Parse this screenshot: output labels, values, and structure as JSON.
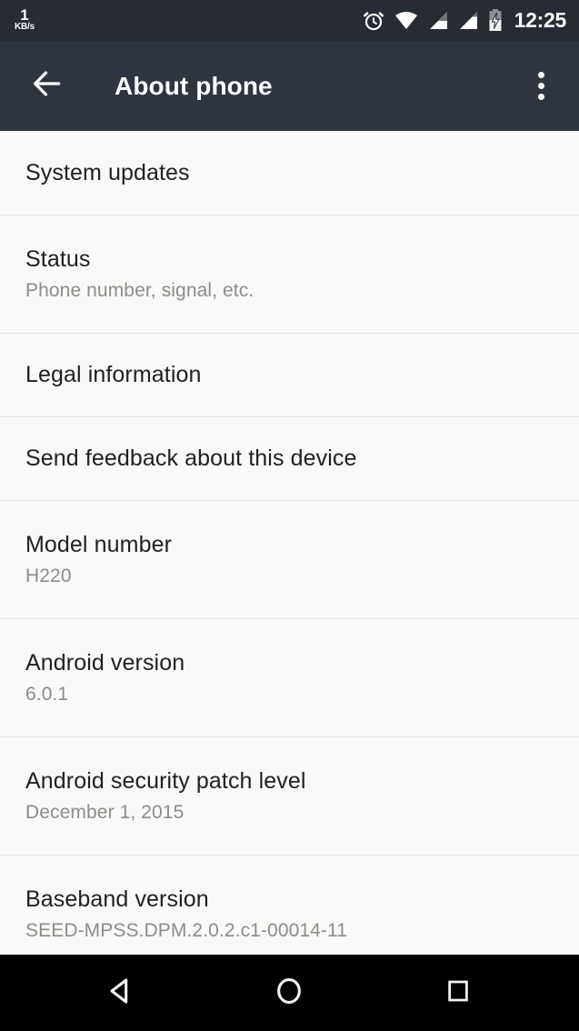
{
  "status_bar": {
    "network_speed_value": "1",
    "network_speed_unit": "KB/s",
    "clock": "12:25",
    "icons": [
      "alarm-clock-icon",
      "wifi-icon",
      "signal-sim1-icon",
      "signal-sim2-icon",
      "battery-charging-icon"
    ],
    "background_color": "#272b33"
  },
  "app_bar": {
    "title": "About phone",
    "back_icon": "arrow-left-icon",
    "overflow_icon": "more-vertical-icon",
    "background_color": "#2f3540"
  },
  "list": {
    "background_color": "#f8faf7",
    "divider_color": "#e2e4e1",
    "items": [
      {
        "title": "System updates",
        "subtitle": null
      },
      {
        "title": "Status",
        "subtitle": "Phone number, signal, etc."
      },
      {
        "title": "Legal information",
        "subtitle": null
      },
      {
        "title": "Send feedback about this device",
        "subtitle": null
      },
      {
        "title": "Model number",
        "subtitle": "H220"
      },
      {
        "title": "Android version",
        "subtitle": "6.0.1"
      },
      {
        "title": "Android security patch level",
        "subtitle": "December 1, 2015"
      },
      {
        "title": "Baseband version",
        "subtitle": "SEED-MPSS.DPM.2.0.2.c1-00014-11"
      }
    ]
  },
  "nav_bar": {
    "background_color": "#000000",
    "buttons": [
      {
        "name": "back-nav-icon"
      },
      {
        "name": "home-nav-icon"
      },
      {
        "name": "recents-nav-icon"
      }
    ]
  }
}
